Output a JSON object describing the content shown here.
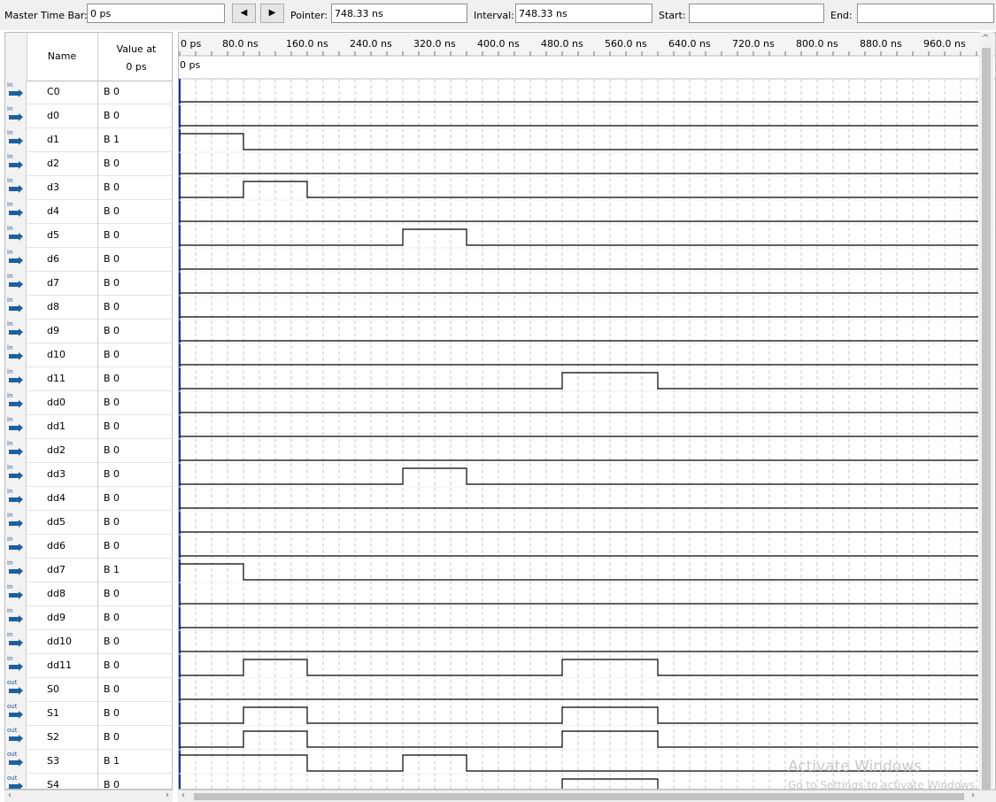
{
  "toolbar": {
    "master_label": "Master Time Bar:",
    "master_value": "0 ps",
    "prev_icon": "arrow-left-icon",
    "next_icon": "arrow-right-icon",
    "pointer_label": "Pointer:",
    "pointer_value": "748.33 ns",
    "interval_label": "Interval:",
    "interval_value": "748.33 ns",
    "start_label": "Start:",
    "start_value": "",
    "end_label": "End:",
    "end_value": ""
  },
  "columns": {
    "name": "Name",
    "value_line1": "Value at",
    "value_line2": "0 ps"
  },
  "time_ruler": {
    "ticks": [
      "0 ps",
      "80.0 ns",
      "160.0 ns",
      "240.0 ns",
      "320.0 ns",
      "400.0 ns",
      "480.0 ns",
      "560.0 ns",
      "640.0 ns",
      "720.0 ns",
      "800.0 ns",
      "880.0 ns",
      "960.0 ns"
    ],
    "marker_label": "0 ps",
    "ns_per_minor": 20
  },
  "signals": [
    {
      "type": "in",
      "name": "C0",
      "value": "B 0",
      "pulses": []
    },
    {
      "type": "in",
      "name": "d0",
      "value": "B 0",
      "pulses": []
    },
    {
      "type": "in",
      "name": "d1",
      "value": "B 1",
      "pulses": [
        [
          0,
          80
        ]
      ]
    },
    {
      "type": "in",
      "name": "d2",
      "value": "B 0",
      "pulses": []
    },
    {
      "type": "in",
      "name": "d3",
      "value": "B 0",
      "pulses": [
        [
          80,
          160
        ]
      ]
    },
    {
      "type": "in",
      "name": "d4",
      "value": "B 0",
      "pulses": []
    },
    {
      "type": "in",
      "name": "d5",
      "value": "B 0",
      "pulses": [
        [
          280,
          360
        ]
      ]
    },
    {
      "type": "in",
      "name": "d6",
      "value": "B 0",
      "pulses": []
    },
    {
      "type": "in",
      "name": "d7",
      "value": "B 0",
      "pulses": []
    },
    {
      "type": "in",
      "name": "d8",
      "value": "B 0",
      "pulses": []
    },
    {
      "type": "in",
      "name": "d9",
      "value": "B 0",
      "pulses": []
    },
    {
      "type": "in",
      "name": "d10",
      "value": "B 0",
      "pulses": []
    },
    {
      "type": "in",
      "name": "d11",
      "value": "B 0",
      "pulses": [
        [
          480,
          600
        ]
      ]
    },
    {
      "type": "in",
      "name": "dd0",
      "value": "B 0",
      "pulses": []
    },
    {
      "type": "in",
      "name": "dd1",
      "value": "B 0",
      "pulses": []
    },
    {
      "type": "in",
      "name": "dd2",
      "value": "B 0",
      "pulses": []
    },
    {
      "type": "in",
      "name": "dd3",
      "value": "B 0",
      "pulses": [
        [
          280,
          360
        ]
      ]
    },
    {
      "type": "in",
      "name": "dd4",
      "value": "B 0",
      "pulses": []
    },
    {
      "type": "in",
      "name": "dd5",
      "value": "B 0",
      "pulses": []
    },
    {
      "type": "in",
      "name": "dd6",
      "value": "B 0",
      "pulses": []
    },
    {
      "type": "in",
      "name": "dd7",
      "value": "B 1",
      "pulses": [
        [
          0,
          80
        ]
      ]
    },
    {
      "type": "in",
      "name": "dd8",
      "value": "B 0",
      "pulses": []
    },
    {
      "type": "in",
      "name": "dd9",
      "value": "B 0",
      "pulses": []
    },
    {
      "type": "in",
      "name": "dd10",
      "value": "B 0",
      "pulses": []
    },
    {
      "type": "in",
      "name": "dd11",
      "value": "B 0",
      "pulses": [
        [
          80,
          160
        ],
        [
          480,
          600
        ]
      ]
    },
    {
      "type": "out",
      "name": "S0",
      "value": "B 0",
      "pulses": []
    },
    {
      "type": "out",
      "name": "S1",
      "value": "B 0",
      "pulses": [
        [
          80,
          160
        ],
        [
          480,
          600
        ]
      ]
    },
    {
      "type": "out",
      "name": "S2",
      "value": "B 0",
      "pulses": [
        [
          80,
          160
        ],
        [
          480,
          600
        ]
      ]
    },
    {
      "type": "out",
      "name": "S3",
      "value": "B 1",
      "pulses": [
        [
          0,
          160
        ],
        [
          280,
          360
        ]
      ]
    },
    {
      "type": "out",
      "name": "S4",
      "value": "B 0",
      "pulses": [
        [
          480,
          600
        ]
      ]
    }
  ],
  "watermark": {
    "line1": "Activate Windows",
    "line2": "Go to Settings to activate Windows."
  }
}
